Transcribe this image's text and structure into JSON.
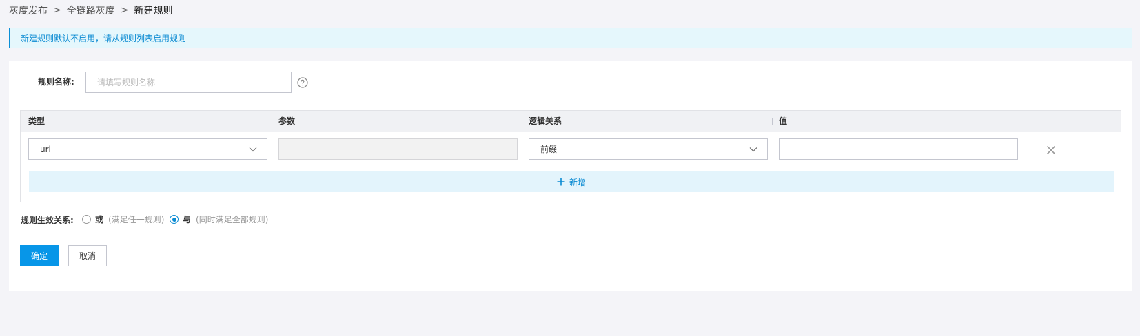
{
  "breadcrumb": {
    "items": [
      "灰度发布",
      "全链路灰度",
      "新建规则"
    ],
    "separator": ">"
  },
  "notice": {
    "text": "新建规则默认不启用，请从规则列表启用规则"
  },
  "form": {
    "name_label": "规则名称:",
    "name_placeholder": "请填写规则名称",
    "name_value": "",
    "help_icon": "question-circle-icon",
    "columns": [
      "类型",
      "参数",
      "逻辑关系",
      "值"
    ],
    "rule_row": {
      "type_value": "uri",
      "param_value": "",
      "logic_value": "前缀",
      "value_value": "",
      "delete_icon": "close-icon"
    },
    "add_label": "新增",
    "relation": {
      "label": "规则生效关系:",
      "options": [
        {
          "label": "或",
          "desc": "(满足任一规则)",
          "checked": false
        },
        {
          "label": "与",
          "desc": "(同时满足全部规则)",
          "checked": true
        }
      ]
    },
    "ok_label": "确定",
    "cancel_label": "取消"
  },
  "colors": {
    "accent": "#0a8ad2",
    "primary_button": "#0796e8",
    "notice_bg": "#e5f7fc",
    "page_bg": "#f4f4f8"
  }
}
